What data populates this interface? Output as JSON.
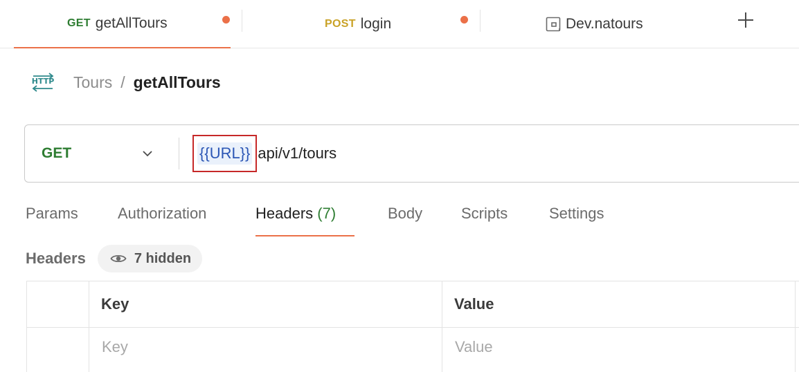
{
  "tabs": [
    {
      "method": "GET",
      "method_color": "#2e7d32",
      "name": "getAllTours",
      "unsaved": true,
      "active": true
    },
    {
      "method": "POST",
      "method_color": "#c9a227",
      "name": "login",
      "unsaved": true,
      "active": false
    },
    {
      "icon": "environment-icon",
      "name": "Dev.natours",
      "active": false
    }
  ],
  "add_tab_icon": "plus-icon",
  "breadcrumb": {
    "icon": "http-icon",
    "parent": "Tours",
    "separator": "/",
    "current": "getAllTours"
  },
  "request": {
    "method": "GET",
    "method_icon": "chevron-down-icon",
    "url_variable": "{{URL}}",
    "url_path": "api/v1/tours"
  },
  "request_tabs": [
    {
      "label": "Params"
    },
    {
      "label": "Authorization"
    },
    {
      "label": "Headers",
      "count": "(7)",
      "active": true
    },
    {
      "label": "Body"
    },
    {
      "label": "Scripts"
    },
    {
      "label": "Settings"
    }
  ],
  "headers_section": {
    "title": "Headers",
    "hidden_label": "7 hidden",
    "hidden_icon": "eye-icon"
  },
  "headers_table": {
    "columns": [
      "Key",
      "Value"
    ],
    "placeholders": {
      "key": "Key",
      "value": "Value"
    }
  },
  "colors": {
    "accent": "#eb7048",
    "get": "#2e7d32",
    "post": "#c9a227",
    "variable": "#2b56b5",
    "highlight_box": "#c62828"
  }
}
